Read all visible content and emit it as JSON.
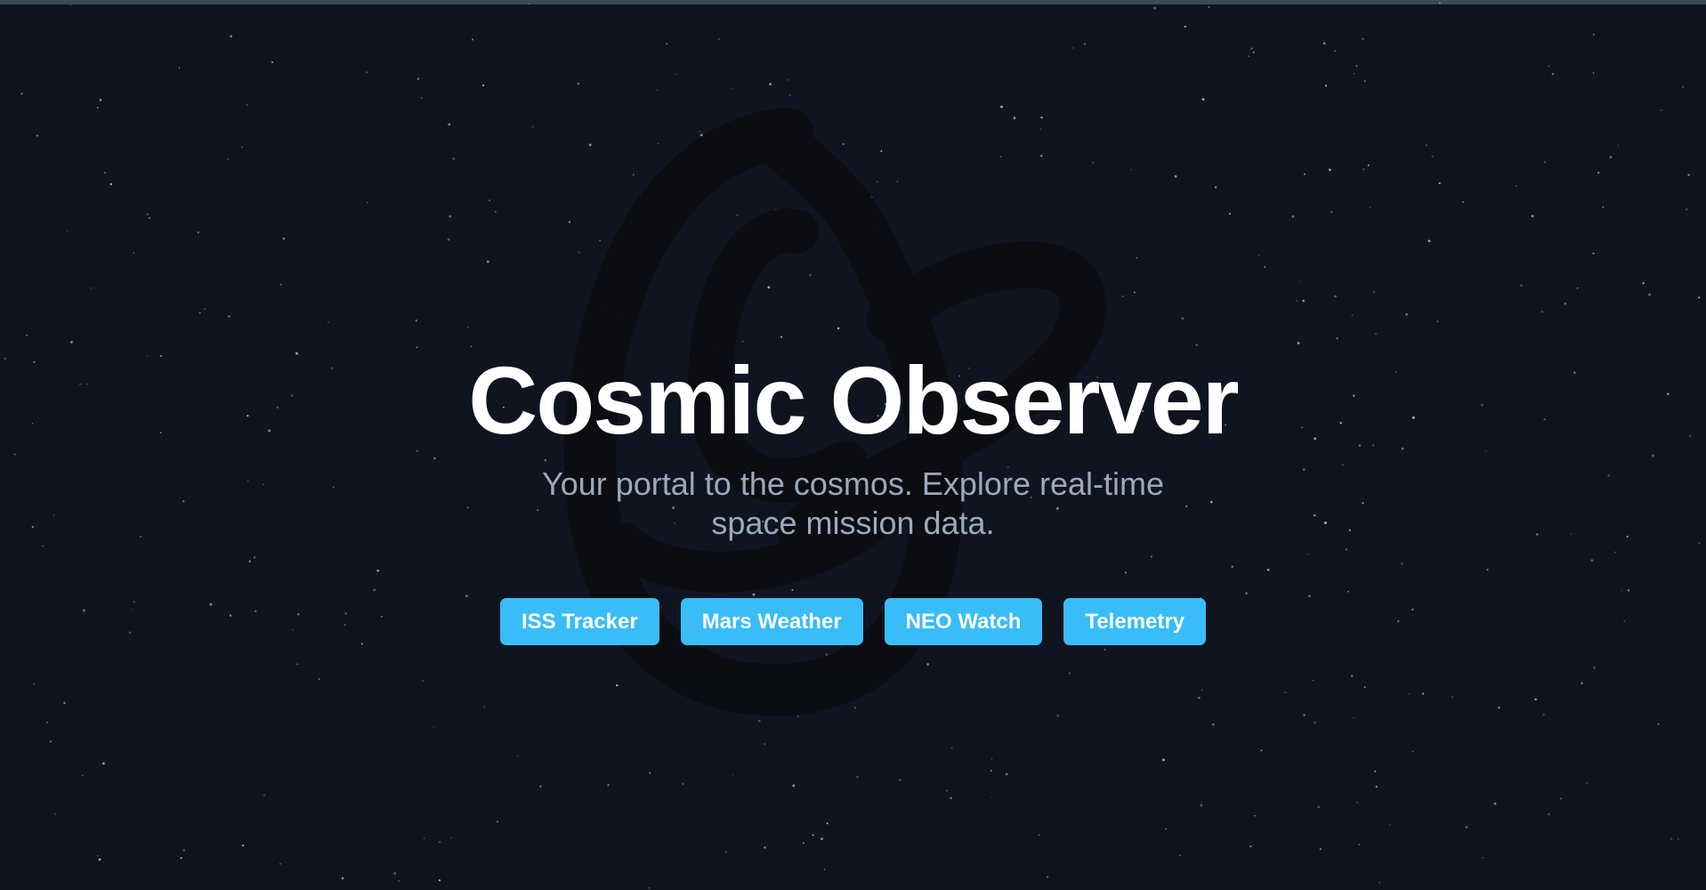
{
  "hero": {
    "title": "Cosmic Observer",
    "subtitle": "Your portal to the cosmos. Explore real-time space mission data."
  },
  "nav": {
    "buttons": [
      {
        "label": "ISS Tracker"
      },
      {
        "label": "Mars Weather"
      },
      {
        "label": "NEO Watch"
      },
      {
        "label": "Telemetry"
      }
    ]
  },
  "theme": {
    "background": "#0f1420",
    "accent": "#38bdf8",
    "title_color": "#ffffff",
    "subtitle_color": "#9ba9bd",
    "top_bar": "#3b4a55"
  },
  "decorations": {
    "background_art": "torus-knot-icon",
    "starfield": "star-icon"
  }
}
